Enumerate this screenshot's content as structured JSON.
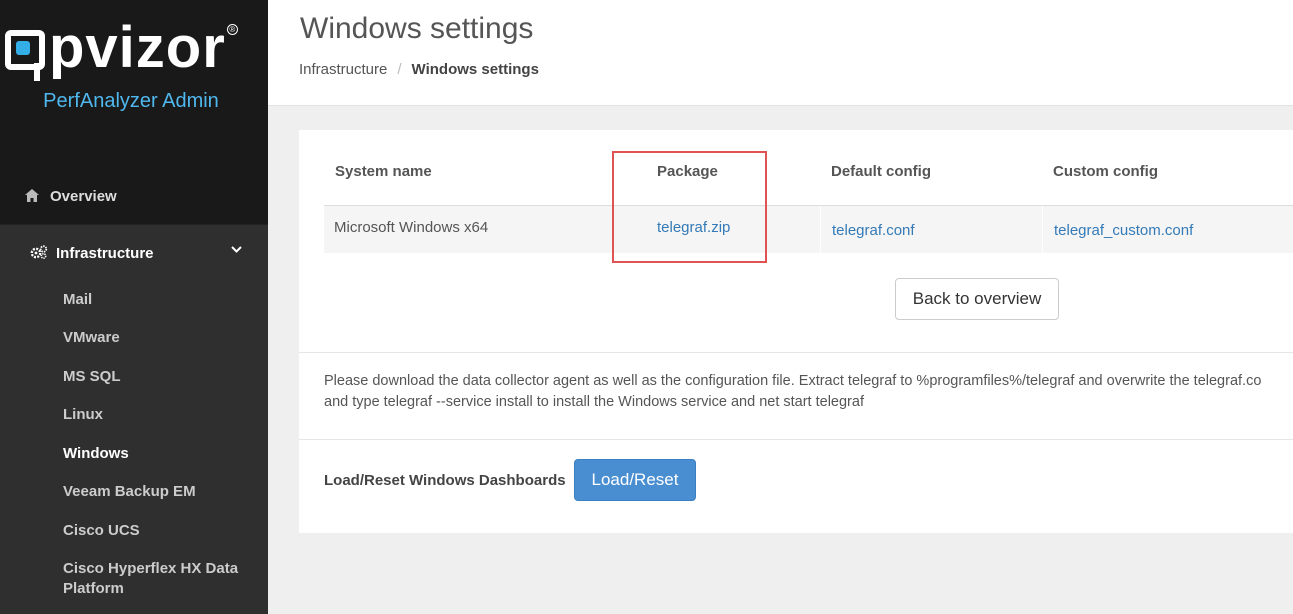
{
  "brand": {
    "logo_text": "pvizor",
    "logo_mark": "opvizor-logo-mark",
    "registered": "®",
    "app_title": "PerfAnalyzer Admin"
  },
  "sidebar": {
    "overview": {
      "label": "Overview",
      "icon": "home-icon"
    },
    "infrastructure": {
      "label": "Infrastructure",
      "icon": "gears-icon",
      "expanded": true
    },
    "sub_items": [
      {
        "label": "Mail"
      },
      {
        "label": "VMware"
      },
      {
        "label": "MS SQL"
      },
      {
        "label": "Linux"
      },
      {
        "label": "Windows",
        "active": true
      },
      {
        "label": "Veeam Backup EM"
      },
      {
        "label": "Cisco UCS"
      },
      {
        "label": "Cisco Hyperflex HX Data Platform"
      }
    ]
  },
  "header": {
    "title": "Windows settings",
    "breadcrumb": [
      "Infrastructure",
      "Windows settings"
    ],
    "breadcrumb_sep": "/"
  },
  "table": {
    "columns": [
      "System name",
      "Package",
      "Default config",
      "Custom config"
    ],
    "rows": [
      [
        "Microsoft Windows x64",
        "telegraf.zip",
        "telegraf.conf",
        "telegraf_custom.conf"
      ]
    ]
  },
  "buttons": {
    "back": "Back to overview",
    "load_reset": "Load/Reset"
  },
  "instructions": {
    "line1": "Please download the data collector agent as well as the configuration file. Extract telegraf to %programfiles%/telegraf and overwrite the telegraf.co",
    "line2": "and type telegraf --service install to install the Windows service and net start telegraf"
  },
  "dashboards": {
    "label": "Load/Reset Windows Dashboards"
  },
  "colors": {
    "accent": "#4fb8ee",
    "link": "#337ab7",
    "primary_button": "#4a8ed2",
    "highlight_box": "#e05353"
  }
}
